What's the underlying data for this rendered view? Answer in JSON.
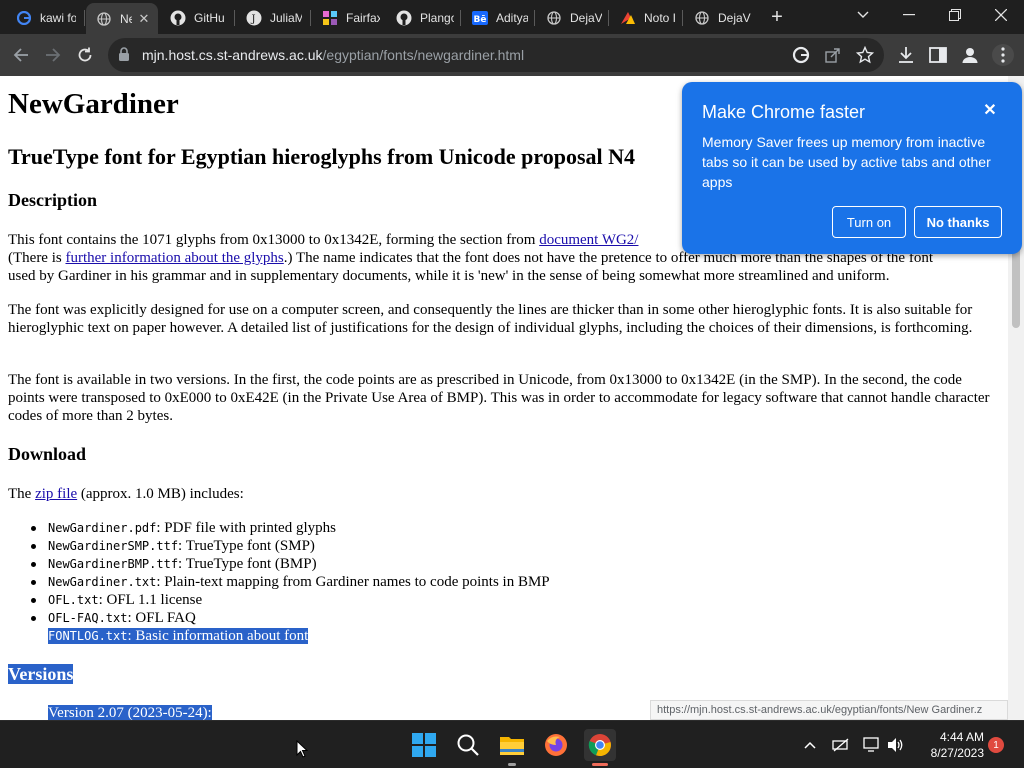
{
  "browser": {
    "tabs": [
      {
        "title": "kawi fo",
        "icon": "google-icon"
      },
      {
        "title": "Ne",
        "icon": "globe-icon",
        "active": true
      },
      {
        "title": "GitHu",
        "icon": "github-icon"
      },
      {
        "title": "JuliaM",
        "icon": "julia-icon"
      },
      {
        "title": "Fairfax",
        "icon": "fairfax-icon"
      },
      {
        "title": "Plango",
        "icon": "github-icon"
      },
      {
        "title": "Aditya",
        "icon": "behance-icon"
      },
      {
        "title": "DejaV",
        "icon": "globe-icon"
      },
      {
        "title": "Noto I",
        "icon": "noto-icon"
      },
      {
        "title": "DejaV",
        "icon": "globe-icon"
      }
    ],
    "new_tab_label": "+",
    "url_host": "mjn.host.cs.st-andrews.ac.uk",
    "url_path": "/egyptian/fonts/newgardiner.html"
  },
  "page": {
    "h1": "NewGardiner",
    "h2": "TrueType font for Egyptian hieroglyphs from Unicode proposal N4",
    "description_heading": "Description",
    "desc_p1_line1_before": "This font contains the 1071 glyphs from 0x13000 to 0x1342E, forming the section from ",
    "desc_p1_link1": "document WG2/",
    "desc_p1_line2_before": "(There is ",
    "desc_p1_link2": "further information about the glyphs",
    "desc_p1_line2_after": ".) The name indicates that the font does not have the pretence to offer much more than the shapes of the font",
    "desc_p1_line3": "used by Gardiner in his grammar and in supplementary documents, while it is 'new' in the sense of being somewhat more streamlined and uniform.",
    "desc_p2": "The font was explicitly designed for use on a computer screen, and consequently the lines are thicker than in some other hieroglyphic fonts. It is also suitable for hieroglyphic text on paper however. A detailed list of justifications for the design of individual glyphs, including the choices of their dimensions, is forthcoming.",
    "desc_p3": "The font is available in two versions. In the first, the code points are as prescribed in Unicode, from 0x13000 to 0x1342E (in the SMP). In the second, the code points were transposed to 0xE000 to 0xE42E (in the Private Use Area of BMP). This was in order to accommodate for legacy software that cannot handle character codes of more than 2 bytes.",
    "download_heading": "Download",
    "download_intro_before": "The ",
    "download_link": "zip file",
    "download_intro_after": " (approx. 1.0 MB) includes:",
    "files": [
      {
        "name": "NewGardiner.pdf",
        "desc": ": PDF file with printed glyphs"
      },
      {
        "name": "NewGardinerSMP.ttf",
        "desc": ": TrueType font (SMP)"
      },
      {
        "name": "NewGardinerBMP.ttf",
        "desc": ": TrueType font (BMP)"
      },
      {
        "name": "NewGardiner.txt",
        "desc": ": Plain-text mapping from Gardiner names to code points in BMP"
      },
      {
        "name": "OFL.txt",
        "desc": ": OFL 1.1 license"
      },
      {
        "name": "OFL-FAQ.txt",
        "desc": ": OFL FAQ"
      },
      {
        "name": "FONTLOG.txt",
        "desc": ": Basic information about font"
      }
    ],
    "versions_heading": "Versions",
    "version_item": "Version 2.07 (2023-05-24):",
    "status_url": "https://mjn.host.cs.st-andrews.ac.uk/egyptian/fonts/New Gardiner.z"
  },
  "popup": {
    "title": "Make Chrome faster",
    "body": "Memory Saver frees up memory from inactive tabs so it can be used by active tabs and other apps",
    "turn_on": "Turn on",
    "no_thanks": "No thanks",
    "color": "#1a73e8"
  },
  "taskbar": {
    "time": "4:44 AM",
    "date": "8/27/2023",
    "notifications": "1"
  }
}
